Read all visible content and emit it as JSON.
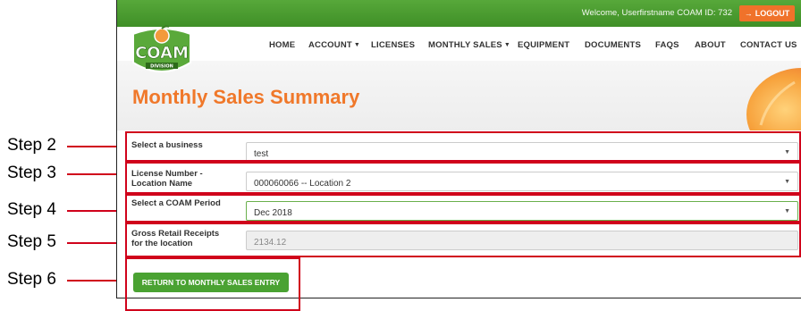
{
  "header": {
    "welcome": "Welcome, Userfirstname COAM ID: 732",
    "logout_label": "LOGOUT"
  },
  "logo": {
    "text": "COAM",
    "subtext": "DIVISION"
  },
  "nav": [
    {
      "label": "HOME"
    },
    {
      "label": "ACCOUNT"
    },
    {
      "label": "LICENSES"
    },
    {
      "label": "MONTHLY SALES"
    },
    {
      "label": "EQUIPMENT"
    },
    {
      "label": "DOCUMENTS"
    },
    {
      "label": "FAQS"
    },
    {
      "label": "ABOUT"
    },
    {
      "label": "CONTACT US"
    }
  ],
  "page": {
    "title": "Monthly Sales Summary"
  },
  "form": {
    "business_label": "Select a business",
    "business_value": "test",
    "license_label": "License Number - Location Name",
    "license_value": "000060066 -- Location 2",
    "period_label": "Select a COAM Period",
    "period_value": "Dec 2018",
    "receipts_label": "Gross Retail Receipts for the location",
    "receipts_value": "2134.12",
    "return_button": "RETURN TO MONTHLY SALES ENTRY"
  },
  "steps": [
    "Step 2",
    "Step 3",
    "Step 4",
    "Step 5",
    "Step 6"
  ],
  "colors": {
    "brand_green": "#4a9a2e",
    "accent_orange": "#f0782a",
    "annotation_red": "#d0021b"
  }
}
